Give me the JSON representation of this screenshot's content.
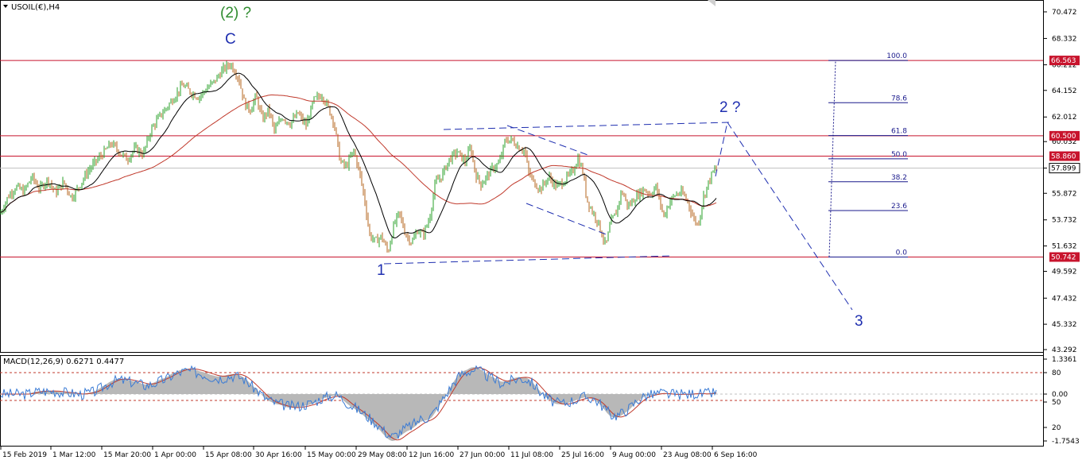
{
  "chart_data": {
    "type": "candlestick",
    "symbol_header": "USOIL(€),H4",
    "price_axis_ticks": [
      "70.472",
      "68.332",
      "66.212",
      "64.152",
      "62.012",
      "60.032",
      "57.899",
      "55.872",
      "53.732",
      "51.632",
      "49.592",
      "47.432",
      "45.332",
      "43.292"
    ],
    "price_range": [
      43.292,
      71.3
    ],
    "horizontal_levels": [
      {
        "price": 66.563,
        "label": "66.563",
        "color": "#c8142d"
      },
      {
        "price": 60.5,
        "label": "60.500",
        "color": "#c8142d"
      },
      {
        "price": 58.86,
        "label": "58.860",
        "color": "#c8142d"
      },
      {
        "price": 50.742,
        "label": "50.742",
        "color": "#c8142d"
      }
    ],
    "current_price": {
      "price": 57.899,
      "label": "57.899"
    },
    "fibonacci": [
      {
        "level": "100.0",
        "price": 66.563
      },
      {
        "level": "78.6",
        "price": 63.16
      },
      {
        "level": "61.8",
        "price": 60.52
      },
      {
        "level": "50.0",
        "price": 58.65
      },
      {
        "level": "38.2",
        "price": 56.8
      },
      {
        "level": "23.6",
        "price": 54.48
      },
      {
        "level": "0.0",
        "price": 50.742
      }
    ],
    "time_labels": [
      "15 Feb 2019",
      "1 Mar 12:00",
      "15 Mar 20:00",
      "1 Apr 00:00",
      "15 Apr 08:00",
      "30 Apr 16:00",
      "15 May 00:00",
      "29 May 08:00",
      "12 Jun 16:00",
      "27 Jun 00:00",
      "11 Jul 08:00",
      "25 Jul 16:00",
      "9 Aug 00:00",
      "23 Aug 08:00",
      "6 Sep 16:00"
    ],
    "wave_labels": [
      {
        "text": "(2) ?",
        "color": "#2e8b2e"
      },
      {
        "text": "C",
        "color": "#1f2fb0"
      },
      {
        "text": "1",
        "color": "#1f2fb0"
      },
      {
        "text": "2 ?",
        "color": "#1f2fb0"
      },
      {
        "text": "3",
        "color": "#1f2fb0"
      }
    ],
    "price_path": [
      [
        0,
        54.2
      ],
      [
        10,
        55.6
      ],
      [
        20,
        56.4
      ],
      [
        30,
        56.0
      ],
      [
        40,
        57.2
      ],
      [
        50,
        56.2
      ],
      [
        60,
        57.0
      ],
      [
        70,
        55.9
      ],
      [
        80,
        56.8
      ],
      [
        90,
        55.5
      ],
      [
        100,
        56.5
      ],
      [
        110,
        57.6
      ],
      [
        120,
        58.4
      ],
      [
        130,
        59.1
      ],
      [
        140,
        59.9
      ],
      [
        150,
        59.2
      ],
      [
        160,
        58.6
      ],
      [
        170,
        59.5
      ],
      [
        180,
        59.0
      ],
      [
        190,
        61.0
      ],
      [
        200,
        62.0
      ],
      [
        210,
        62.8
      ],
      [
        220,
        63.7
      ],
      [
        230,
        64.6
      ],
      [
        240,
        64.0
      ],
      [
        250,
        63.6
      ],
      [
        260,
        64.3
      ],
      [
        270,
        64.9
      ],
      [
        280,
        65.8
      ],
      [
        290,
        66.3
      ],
      [
        300,
        65.2
      ],
      [
        308,
        63.0
      ],
      [
        315,
        62.6
      ],
      [
        322,
        63.7
      ],
      [
        330,
        61.8
      ],
      [
        338,
        62.6
      ],
      [
        345,
        60.9
      ],
      [
        355,
        62.0
      ],
      [
        365,
        61.5
      ],
      [
        375,
        62.3
      ],
      [
        385,
        61.3
      ],
      [
        395,
        63.4
      ],
      [
        405,
        63.8
      ],
      [
        412,
        62.9
      ],
      [
        420,
        61.6
      ],
      [
        428,
        58.4
      ],
      [
        435,
        58.0
      ],
      [
        445,
        59.3
      ],
      [
        452,
        57.6
      ],
      [
        458,
        55.6
      ],
      [
        465,
        52.5
      ],
      [
        472,
        52.0
      ],
      [
        480,
        52.4
      ],
      [
        488,
        51.1
      ],
      [
        495,
        53.2
      ],
      [
        502,
        54.3
      ],
      [
        510,
        52.6
      ],
      [
        518,
        51.9
      ],
      [
        525,
        52.9
      ],
      [
        532,
        52.5
      ],
      [
        540,
        53.8
      ],
      [
        548,
        56.8
      ],
      [
        555,
        57.2
      ],
      [
        565,
        58.6
      ],
      [
        575,
        59.2
      ],
      [
        585,
        58.4
      ],
      [
        592,
        59.6
      ],
      [
        598,
        57.4
      ],
      [
        605,
        56.6
      ],
      [
        612,
        57.2
      ],
      [
        620,
        57.9
      ],
      [
        628,
        58.3
      ],
      [
        636,
        60.2
      ],
      [
        645,
        60.1
      ],
      [
        652,
        59.6
      ],
      [
        660,
        59.3
      ],
      [
        665,
        57.5
      ],
      [
        672,
        56.7
      ],
      [
        680,
        56.2
      ],
      [
        690,
        57.2
      ],
      [
        700,
        56.4
      ],
      [
        710,
        56.9
      ],
      [
        720,
        57.6
      ],
      [
        727,
        58.7
      ],
      [
        733,
        57.6
      ],
      [
        738,
        55.4
      ],
      [
        745,
        54.4
      ],
      [
        752,
        53.6
      ],
      [
        758,
        52.4
      ],
      [
        762,
        51.6
      ],
      [
        768,
        53.5
      ],
      [
        775,
        54.3
      ],
      [
        782,
        56.1
      ],
      [
        790,
        54.8
      ],
      [
        800,
        55.6
      ],
      [
        810,
        56.2
      ],
      [
        818,
        55.8
      ],
      [
        825,
        56.4
      ],
      [
        835,
        54.0
      ],
      [
        842,
        55.2
      ],
      [
        850,
        55.8
      ],
      [
        858,
        55.9
      ],
      [
        865,
        55.2
      ],
      [
        872,
        53.9
      ],
      [
        878,
        53.3
      ],
      [
        885,
        55.6
      ],
      [
        892,
        56.9
      ],
      [
        897,
        57.6
      ],
      [
        902,
        57.9
      ]
    ],
    "macd_header": "MACD(12,26,9) 0.6271 0.4477",
    "macd_axis_ticks": [
      "1.3361",
      "80",
      "0.00",
      "50",
      "20",
      "-1.7543"
    ],
    "macd_range": [
      -1.7543,
      1.3361
    ]
  }
}
